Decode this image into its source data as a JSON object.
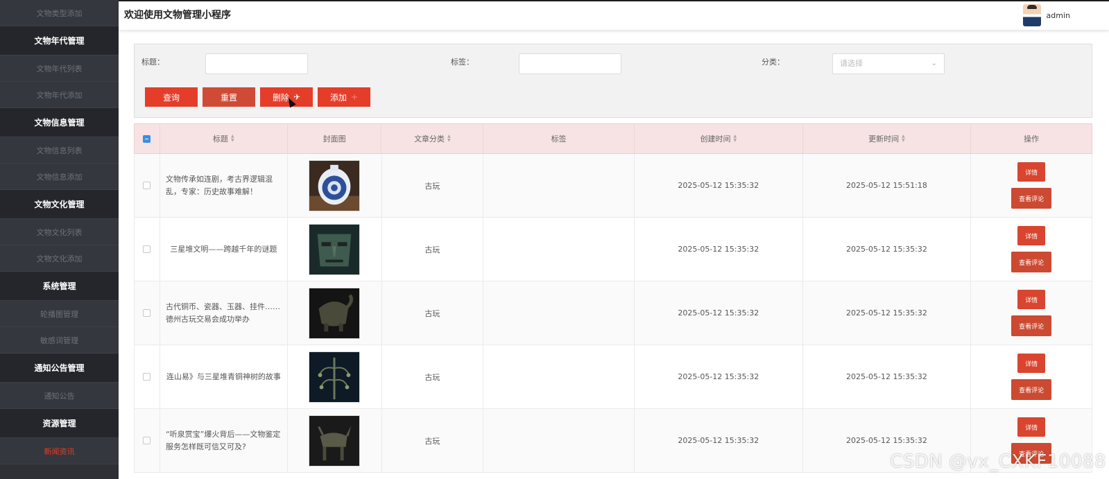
{
  "sidebar": {
    "items": [
      {
        "label": "文物类型添加",
        "kind": "sub"
      },
      {
        "label": "文物年代管理",
        "kind": "section"
      },
      {
        "label": "文物年代列表",
        "kind": "sub"
      },
      {
        "label": "文物年代添加",
        "kind": "sub"
      },
      {
        "label": "文物信息管理",
        "kind": "section"
      },
      {
        "label": "文物信息列表",
        "kind": "sub"
      },
      {
        "label": "文物信息添加",
        "kind": "sub"
      },
      {
        "label": "文物文化管理",
        "kind": "section"
      },
      {
        "label": "文物文化列表",
        "kind": "sub"
      },
      {
        "label": "文物文化添加",
        "kind": "sub"
      },
      {
        "label": "系统管理",
        "kind": "section"
      },
      {
        "label": "轮播图管理",
        "kind": "sub"
      },
      {
        "label": "敏感词管理",
        "kind": "sub"
      },
      {
        "label": "通知公告管理",
        "kind": "section"
      },
      {
        "label": "通知公告",
        "kind": "sub"
      },
      {
        "label": "资源管理",
        "kind": "section"
      },
      {
        "label": "新闻资讯",
        "kind": "sub",
        "active": true
      }
    ]
  },
  "header": {
    "title": "欢迎使用文物管理小程序",
    "username": "admin",
    "avatar_icon": "user-avatar-icon"
  },
  "search": {
    "title_label": "标题：",
    "title_value": "",
    "tag_label": "标签：",
    "tag_value": "",
    "category_label": "分类：",
    "category_placeholder": "请选择",
    "buttons": {
      "query": "查询",
      "reset": "重置",
      "delete": "删除",
      "add": "添加"
    }
  },
  "table": {
    "headers": {
      "title": "标题",
      "cover": "封面图",
      "category": "文章分类",
      "tag": "标签",
      "created": "创建时间",
      "updated": "更新时间",
      "ops": "操作"
    },
    "detail_label": "详情",
    "comment_label": "查看评论",
    "rows": [
      {
        "title": "文物传承如连剧，考古界逻辑混乱，专家：历史故事难解！",
        "category": "古玩",
        "tag": "",
        "created": "2025-05-12 15:35:32",
        "updated": "2025-05-12 15:51:18",
        "cover": "blue-white-porcelain-flask"
      },
      {
        "title": "三星堆文明——跨越千年的谜题",
        "category": "古玩",
        "tag": "",
        "created": "2025-05-12 15:35:32",
        "updated": "2025-05-12 15:35:32",
        "cover": "bronze-mask"
      },
      {
        "title": "古代铜币、瓷器、玉器、挂件……德州古玩交易会成功举办",
        "category": "古玩",
        "tag": "",
        "created": "2025-05-12 15:35:32",
        "updated": "2025-05-12 15:35:32",
        "cover": "bronze-vessel"
      },
      {
        "title": "连山易》与三星堆青铜神树的故事",
        "category": "古玩",
        "tag": "",
        "created": "2025-05-12 15:35:32",
        "updated": "2025-05-12 15:35:32",
        "cover": "bronze-tree"
      },
      {
        "title": "“听泉赏宝”爆火背后——文物鉴定服务怎样既可信又可及?",
        "category": "古玩",
        "tag": "",
        "created": "2025-05-12 15:35:32",
        "updated": "2025-05-12 15:35:32",
        "cover": "bronze-animal"
      }
    ]
  },
  "watermark": "CSDN @vx_CXKF10088",
  "colors": {
    "sidebar_bg": "#2e3035",
    "accent": "#e43d2a",
    "header_row_bg": "#f7e3e3"
  }
}
